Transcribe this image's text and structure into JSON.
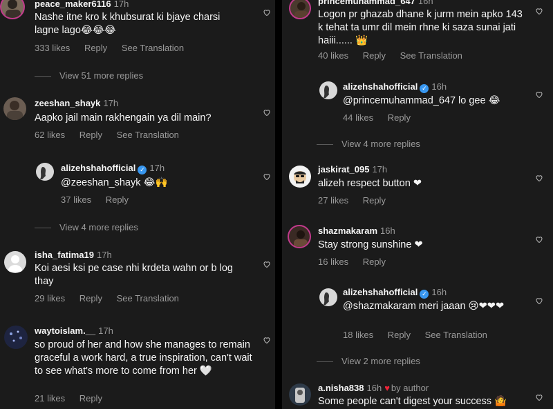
{
  "labels": {
    "reply": "Reply",
    "see_translation": "See Translation"
  },
  "left": {
    "c1": {
      "username": "peace_maker6116",
      "time": "17h",
      "text": "Nashe itne kro k khubsurat ki bjaye charsi lagne lago😂😂😂",
      "likes": "333 likes"
    },
    "more1": "View 51 more replies",
    "c2": {
      "username": "zeeshan_shayk",
      "time": "17h",
      "text": "Aapko jail main rakhengain ya dil main?",
      "likes": "62 likes"
    },
    "r2": {
      "username": "alizehshahofficial",
      "time": "17h",
      "text": "@zeeshan_shayk 😂🙌",
      "likes": "37 likes"
    },
    "more2": "View 4 more replies",
    "c3": {
      "username": "isha_fatima19",
      "time": "17h",
      "text": "Koi aesi ksi pe case nhi krdeta wahn or b log thay",
      "likes": "29 likes"
    },
    "c4": {
      "username": "waytoislam.__",
      "time": "17h",
      "text": "so proud of her and how she manages to remain graceful a work hard, a true inspiration, can't wait to see what's more to come from her 🤍",
      "likes": "21 likes"
    }
  },
  "right": {
    "c1": {
      "username": "princemuhammad_647",
      "time": "16h",
      "text": "Logon pr ghazab dhane k jurm mein apko 143 k tehat  ta umr dil mein rhne ki saza sunai jati haiii...... 👑",
      "likes": "40 likes"
    },
    "r1": {
      "username": "alizehshahofficial",
      "time": "16h",
      "text": "@princemuhammad_647 lo gee 😂",
      "likes": "44 likes"
    },
    "more1": "View 4 more replies",
    "c2": {
      "username": "jaskirat_095",
      "time": "17h",
      "text": "alizeh respect button ❤",
      "likes": "27 likes"
    },
    "c3": {
      "username": "shazmakaram",
      "time": "16h",
      "text": "Stay strong sunshine ❤",
      "likes": "16 likes"
    },
    "r3": {
      "username": "alizehshahofficial",
      "time": "16h",
      "text": "@shazmakaram meri jaaan 😢❤❤❤",
      "likes": "18 likes"
    },
    "more2": "View 2 more replies",
    "c4": {
      "username": "a.nisha838",
      "time": "16h",
      "by_author": "by author",
      "text": "Some people can't digest your success 🤷",
      "likes": ""
    }
  },
  "colors": {
    "background": "#1b1b1b",
    "text": "#f5f5f5",
    "muted": "#9a9a9a",
    "verified": "#3897f0",
    "heart": "#ed2438"
  },
  "icons": [
    "heart-outline-icon",
    "verified-badge-icon",
    "liked-by-author-heart-icon"
  ]
}
